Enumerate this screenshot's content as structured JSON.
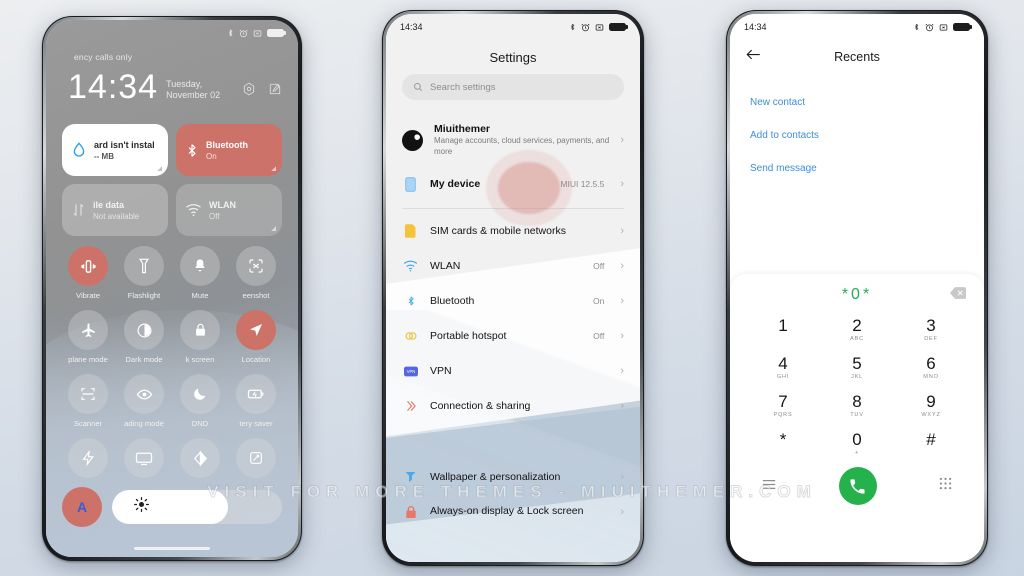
{
  "watermark": "VISIT FOR MORE THEMES - MIUITHEMER.COM",
  "colors": {
    "accent_red": "#cd7268",
    "link_blue": "#3d8ddd",
    "call_green": "#25b24c",
    "dialed_green": "#1fae52"
  },
  "phone1": {
    "statusbar": {
      "time": "",
      "icons": [
        "bluetooth-icon",
        "alarm-icon",
        "screenshot-icon",
        "battery-icon"
      ]
    },
    "carrier": "ency calls only",
    "clock": "14:34",
    "date": "Tuesday, November 02",
    "lock_actions": [
      "camera-icon",
      "edit-icon"
    ],
    "cards": [
      {
        "title": "ard isn't instal",
        "subtitle": "-- MB",
        "icon": "water-drop-icon",
        "style": "white"
      },
      {
        "title": "Bluetooth",
        "subtitle": "On",
        "icon": "bluetooth-icon",
        "style": "red"
      },
      {
        "title": "ile data",
        "subtitle": "Not available",
        "icon": "data-transfer-icon",
        "style": "ghost"
      },
      {
        "title": "WLAN",
        "subtitle": "Off",
        "icon": "wifi-icon",
        "style": "ghost2"
      }
    ],
    "toggles": [
      {
        "label": "Vibrate",
        "icon": "vibrate-icon",
        "on": true
      },
      {
        "label": "Flashlight",
        "icon": "flashlight-icon",
        "on": false
      },
      {
        "label": "Mute",
        "icon": "bell-icon",
        "on": false
      },
      {
        "label": "eenshot",
        "icon": "screenshot-icon",
        "on": false
      },
      {
        "label": "plane mode",
        "icon": "airplane-icon",
        "on": false
      },
      {
        "label": "Dark mode",
        "icon": "darkmode-icon",
        "on": false
      },
      {
        "label": "k screen",
        "icon": "lock-icon",
        "on": false
      },
      {
        "label": "Location",
        "icon": "location-icon",
        "on": true
      },
      {
        "label": "Scanner",
        "icon": "scanner-icon",
        "on": false
      },
      {
        "label": "ading mode",
        "icon": "eye-icon",
        "on": false
      },
      {
        "label": "DND",
        "icon": "moon-icon",
        "on": false
      },
      {
        "label": "tery saver",
        "icon": "battery-saver-icon",
        "on": false
      },
      {
        "label": "",
        "icon": "lightning-icon",
        "on": false
      },
      {
        "label": "",
        "icon": "cast-icon",
        "on": false
      },
      {
        "label": "",
        "icon": "ultra-battery-icon",
        "on": false
      },
      {
        "label": "",
        "icon": "rotate-icon",
        "on": false
      }
    ],
    "brightness": {
      "auto_label": "A",
      "icon": "brightness-icon",
      "level_percent": 68
    }
  },
  "phone2": {
    "statusbar": {
      "time": "14:34",
      "icons": [
        "bluetooth-icon",
        "alarm-icon",
        "screenshot-icon",
        "battery-icon"
      ]
    },
    "title": "Settings",
    "search_placeholder": "Search settings",
    "account": {
      "name": "Miuithemer",
      "subtitle": "Manage accounts, cloud services, payments, and more",
      "icon": "avatar"
    },
    "device": {
      "label": "My device",
      "value": "MIUI 12.5.5",
      "icon": "device-icon"
    },
    "items": [
      {
        "label": "SIM cards & mobile networks",
        "value": "",
        "icon": "sim-icon"
      },
      {
        "label": "WLAN",
        "value": "Off",
        "icon": "wifi-icon"
      },
      {
        "label": "Bluetooth",
        "value": "On",
        "icon": "bluetooth-icon"
      },
      {
        "label": "Portable hotspot",
        "value": "Off",
        "icon": "hotspot-icon"
      },
      {
        "label": "VPN",
        "value": "",
        "icon": "vpn-icon"
      },
      {
        "label": "Connection & sharing",
        "value": "",
        "icon": "connection-icon"
      }
    ],
    "items2": [
      {
        "label": "Wallpaper & personalization",
        "value": "",
        "icon": "wallpaper-icon"
      },
      {
        "label": "Always-on display & Lock screen",
        "value": "",
        "icon": "lock-icon"
      }
    ]
  },
  "phone3": {
    "statusbar": {
      "time": "14:34",
      "icons": [
        "bluetooth-icon",
        "alarm-icon",
        "screenshot-icon",
        "battery-icon"
      ]
    },
    "title": "Recents",
    "back_icon": "back-arrow-icon",
    "links": [
      "New contact",
      "Add to contacts",
      "Send message"
    ],
    "dialed_number": "*0*",
    "delete_icon": "backspace-icon",
    "keys": [
      {
        "digit": "1",
        "letters": ""
      },
      {
        "digit": "2",
        "letters": "ABC"
      },
      {
        "digit": "3",
        "letters": "DEF"
      },
      {
        "digit": "4",
        "letters": "GHI"
      },
      {
        "digit": "5",
        "letters": "JKL"
      },
      {
        "digit": "6",
        "letters": "MNO"
      },
      {
        "digit": "7",
        "letters": "PQRS"
      },
      {
        "digit": "8",
        "letters": "TUV"
      },
      {
        "digit": "9",
        "letters": "WXYZ"
      },
      {
        "digit": "*",
        "letters": ""
      },
      {
        "digit": "0",
        "letters": "+"
      },
      {
        "digit": "#",
        "letters": ""
      }
    ],
    "actions": {
      "menu_icon": "menu-icon",
      "call_icon": "call-icon",
      "keypad_icon": "keypad-icon"
    }
  }
}
